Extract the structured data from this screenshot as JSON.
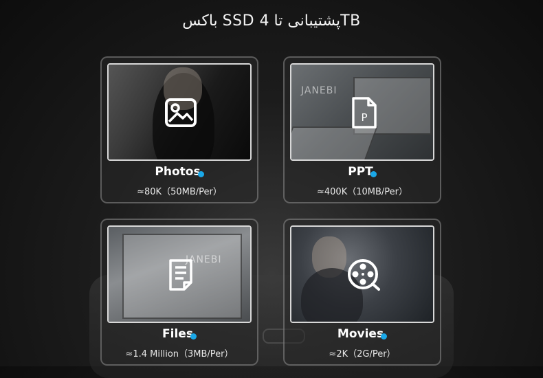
{
  "header": {
    "title": "باکس SSD پشتیبانی تا 4TB"
  },
  "watermark": "JANEBI",
  "accent_color": "#1aa8e8",
  "cards": [
    {
      "label": "Photos",
      "capacity": "≈80K（50MB/Per）",
      "icon": "image-icon"
    },
    {
      "label": "PPT",
      "capacity": "≈400K（10MB/Per）",
      "icon": "ppt-file-icon"
    },
    {
      "label": "Files",
      "capacity": "≈1.4 Million（3MB/Per）",
      "icon": "document-icon"
    },
    {
      "label": "Movies",
      "capacity": "≈2K（2G/Per）",
      "icon": "film-reel-icon"
    }
  ]
}
